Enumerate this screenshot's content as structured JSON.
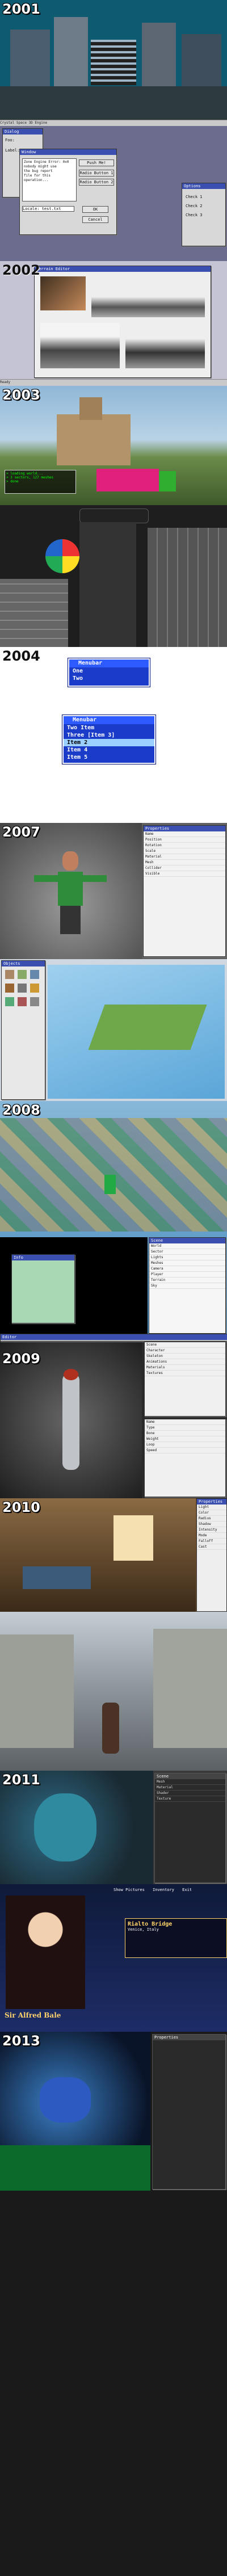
{
  "years": {
    "y2001": "2001",
    "y2002": "2002",
    "y2003": "2003",
    "y2004": "2004",
    "y2007": "2007",
    "y2008": "2008",
    "y2009": "2009",
    "y2010": "2010",
    "y2011": "2011",
    "y2013": "2013"
  },
  "p2001": {
    "title": "CEL Test Application - 3D Viewport",
    "dialog_left": {
      "title": "Dialog",
      "field_label": "Foo:",
      "field_label2": "Label:"
    },
    "dialog_center": {
      "title": "Window",
      "push_label": "Push Me!",
      "radio1": "Radio Button 1",
      "radio2": "Radio Button 2",
      "text_lines": [
        "Zone Engine Error: 0x0",
        "nobody might use",
        "the bug report",
        "file for this",
        "operation..."
      ],
      "input_label": "Locale: test.txt",
      "ok_label": "OK",
      "cancel_label": "Cancel"
    },
    "dialog_small": {
      "title": "Options",
      "items": [
        "Check 1",
        "Check 2",
        "Check 3"
      ]
    },
    "status": "Crystal Space 3D Engine"
  },
  "p2002": {
    "title": "Terrain Editor",
    "menu": [
      "File",
      "Edit",
      "View",
      "Tools",
      "Help"
    ],
    "status": "Ready"
  },
  "p2003": {
    "console_lines": [
      "> loading world...",
      "> 3 sectors, 127 meshes",
      "> done"
    ]
  },
  "p2004": {
    "menu1": {
      "header": "Menubar",
      "items": [
        "One",
        "Two"
      ]
    },
    "menu2": {
      "header": "Menubar",
      "items": [
        "Two Item",
        "Three [Item 3]",
        "Item 2",
        "Item 4",
        "Item 5"
      ],
      "selected_index": 2
    }
  },
  "p2007": {
    "props_title": "Properties",
    "props": [
      "Name",
      "Position",
      "Rotation",
      "Scale",
      "Material",
      "Mesh",
      "Collider",
      "Visible"
    ]
  },
  "p2008": {
    "palette_title": "Objects",
    "tree_title": "Scene",
    "tree_items": [
      "World",
      "Sector",
      "Lights",
      "Meshes",
      "Camera",
      "Player",
      "Terrain",
      "Sky"
    ],
    "dialog_title": "Info"
  },
  "p2009": {
    "window_title": "Editor",
    "tree_items": [
      "Scene",
      "Character",
      "Skeleton",
      "Animations",
      "Materials",
      "Textures"
    ],
    "props": [
      "Name",
      "Type",
      "Bone",
      "Weight",
      "Loop",
      "Speed"
    ]
  },
  "p2010": {
    "panel_title": "Properties",
    "rows": [
      "Light",
      "Color",
      "Radius",
      "Shadow",
      "Intensity",
      "Mode",
      "Falloff",
      "Cast"
    ]
  },
  "p2011": {
    "panel_title": "Scene",
    "rows": [
      "Mesh",
      "Material",
      "Shader",
      "Texture"
    ]
  },
  "p2012": {
    "character_name": "Sir Alfred Bale",
    "menu_items": [
      "Show Pictures",
      "Inventory",
      "Exit"
    ],
    "tooltip_title": "Rialto Bridge",
    "tooltip_sub": "Venice, Italy"
  },
  "p2013": {
    "panel_title": "Properties"
  },
  "colors": {
    "win_blue": "#3a4fb0",
    "menu_blue": "#1a3cc8",
    "select_blue": "#9bd0ff"
  }
}
